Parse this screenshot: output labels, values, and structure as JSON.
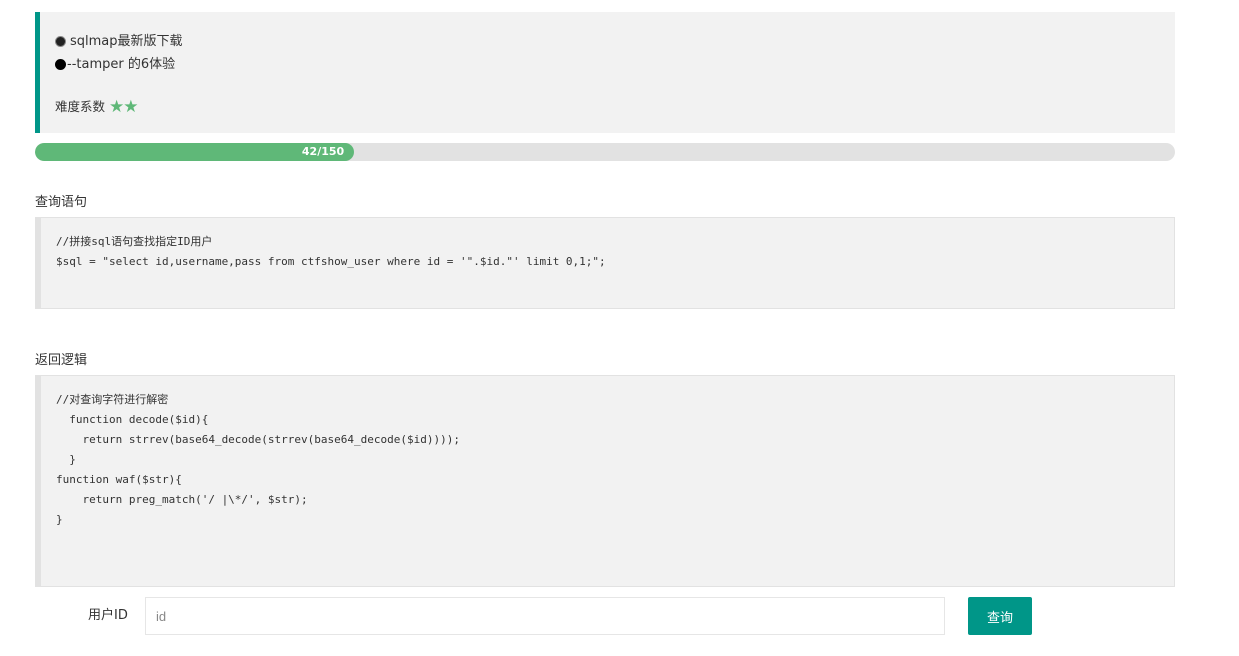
{
  "intro": {
    "bullets": [
      {
        "icon": "radio-dot-icon",
        "text": "sqlmap最新版下载"
      },
      {
        "icon": "black-circle-icon",
        "text": "--tamper 的6体验"
      }
    ],
    "difficulty_label": "难度系数",
    "difficulty_stars": "★★",
    "difficulty_rating": 2
  },
  "progress": {
    "text": "42/150",
    "current": 42,
    "total": 150,
    "color": "#5FB878"
  },
  "sql_section": {
    "title": "查询语句",
    "lines": [
      "//拼接sql语句查找指定ID用户",
      "$sql = \"select id,username,pass from ctfshow_user where id = '\".$id.\"' limit 0,1;\";"
    ]
  },
  "logic_section": {
    "title": "返回逻辑",
    "lines": [
      "//对查询字符进行解密",
      "  function decode($id){",
      "    return strrev(base64_decode(strrev(base64_decode($id))));",
      "  }",
      "function waf($str){",
      "    return preg_match('/ |\\*/', $str);",
      "}"
    ]
  },
  "form": {
    "label": "用户ID",
    "input_placeholder": "id",
    "input_value": "",
    "submit_label": "查询"
  },
  "colors": {
    "accent": "#009688",
    "progress": "#5FB878",
    "panel": "#f2f2f2"
  }
}
